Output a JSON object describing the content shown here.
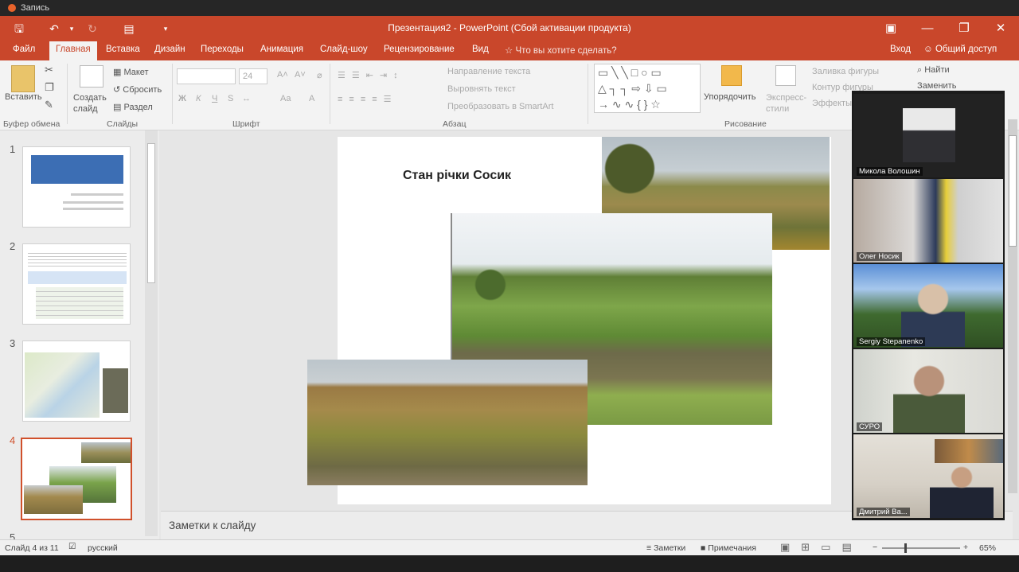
{
  "os": {
    "title": "Запись"
  },
  "window": {
    "title": "Презентация2 - PowerPoint (Сбой активации продукта)"
  },
  "tabs": [
    "Файл",
    "Главная",
    "Вставка",
    "Дизайн",
    "Переходы",
    "Анимация",
    "Слайд-шоу",
    "Рецензирование",
    "Вид"
  ],
  "tell_me": "Что вы хотите сделать?",
  "account": {
    "signin": "Вход",
    "share": "Общий доступ"
  },
  "ribbon": {
    "clipboard": {
      "paste": "Вставить",
      "group": "Буфер обмена"
    },
    "slides": {
      "new_slide": "Создать слайд",
      "layout": "Макет",
      "reset": "Сбросить",
      "section": "Раздел",
      "group": "Слайды"
    },
    "font": {
      "size": "24",
      "bold": "Ж",
      "italic": "К",
      "underline": "Ч",
      "strike": "S",
      "group": "Шрифт"
    },
    "paragraph": {
      "direction": "Направление текста",
      "align": "Выровнять текст",
      "smartart": "Преобразовать в SmartArt",
      "group": "Абзац"
    },
    "drawing": {
      "arrange": "Упорядочить",
      "quick_styles": "Экспресс-стили",
      "fill": "Заливка фигуры",
      "outline": "Контур фигуры",
      "effects": "Эффекты",
      "group": "Рисование"
    },
    "editing": {
      "find": "Найти",
      "replace": "Заменить"
    }
  },
  "slides": [
    {
      "num": "1"
    },
    {
      "num": "2"
    },
    {
      "num": "3"
    },
    {
      "num": "4"
    },
    {
      "num": "5"
    }
  ],
  "slide": {
    "title": "Стан річки Сосик"
  },
  "notes": {
    "placeholder": "Заметки к слайду"
  },
  "status": {
    "slide_of": "Слайд 4 из 11",
    "language": "русский",
    "notes": "Заметки",
    "comments": "Примечания",
    "zoom": "65%"
  },
  "participants": [
    {
      "name": "Микола Волошин"
    },
    {
      "name": "Олег Носик"
    },
    {
      "name": "Sergiy Stepanenko"
    },
    {
      "name": "СУРО"
    },
    {
      "name": "Дмитрий Ва..."
    }
  ],
  "colors": {
    "accent": "#c9472b",
    "selection": "#d0502b"
  }
}
